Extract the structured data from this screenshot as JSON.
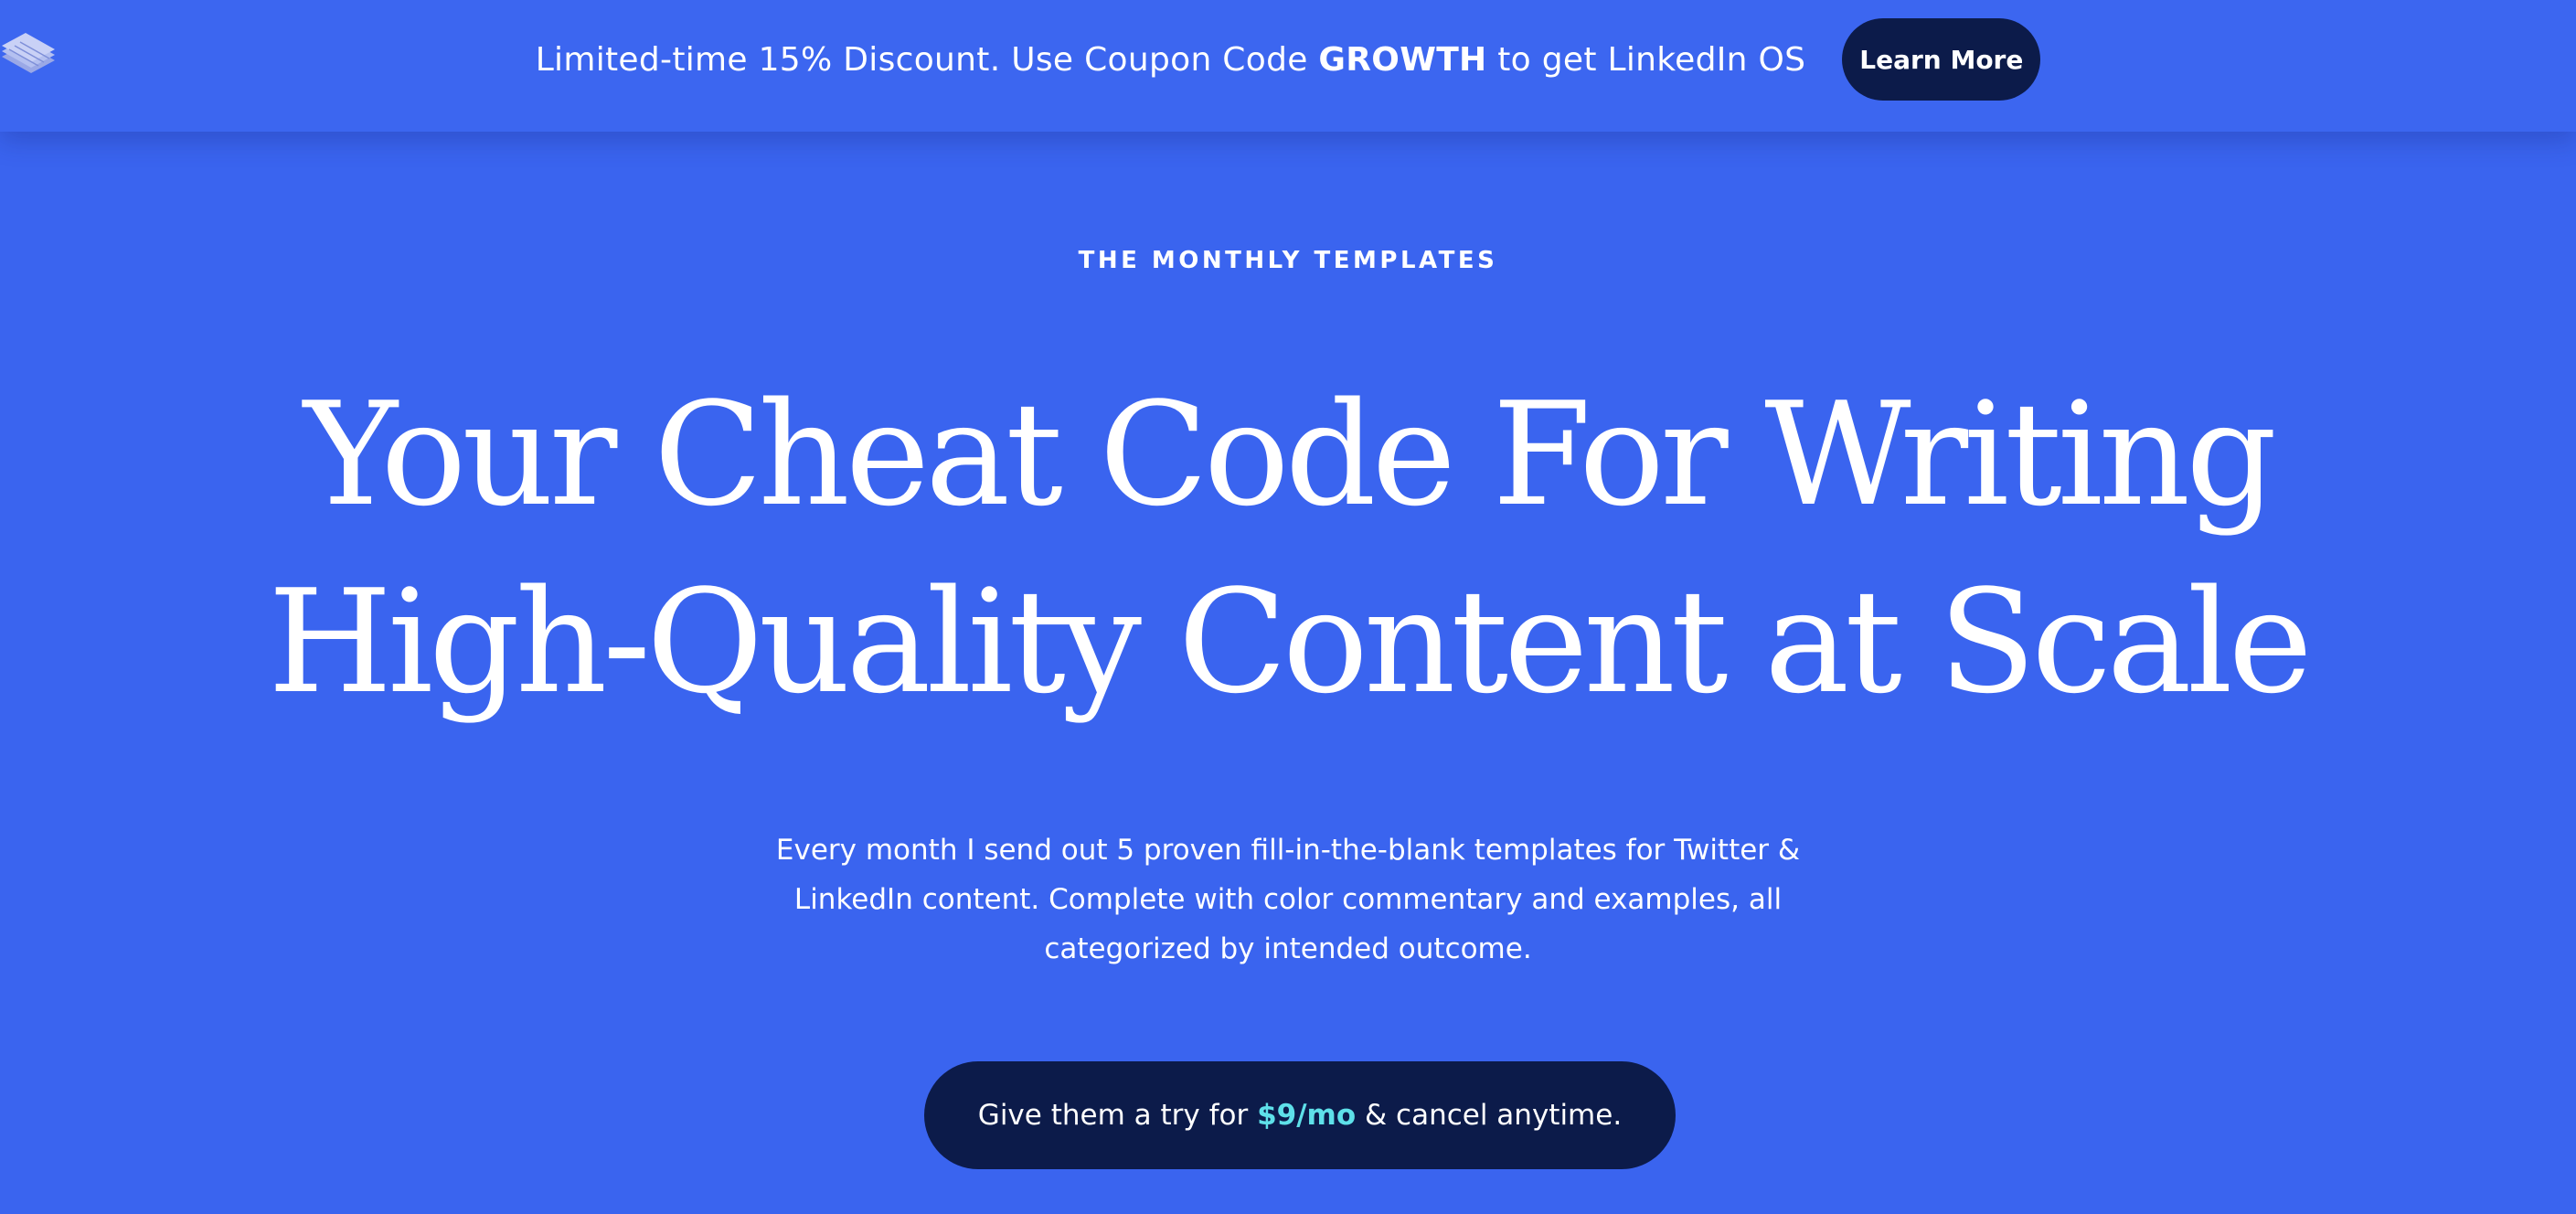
{
  "banner": {
    "text_before": "Limited-time 15% Discount. Use Coupon Code ",
    "coupon_code": "GROWTH",
    "text_after": " to get LinkedIn OS",
    "learn_more_label": "Learn More",
    "logo_icon": "stacked-layers-icon"
  },
  "hero": {
    "eyebrow": "THE MONTHLY TEMPLATES",
    "headline_line1": "Your Cheat Code For Writing",
    "headline_line2": "High-Quality Content at Scale",
    "description": "Every month I send out 5 proven fill-in-the-blank templates for Twitter & LinkedIn content. Complete with color commentary and examples, all categorized by intended outcome."
  },
  "cta": {
    "text_before": "Give them a try for ",
    "price": "$9/mo",
    "text_after": " & cancel anytime."
  },
  "colors": {
    "background": "#3a64ef",
    "button_dark": "#0c1b4a",
    "price_accent": "#5ee0e9",
    "text": "#ffffff"
  }
}
